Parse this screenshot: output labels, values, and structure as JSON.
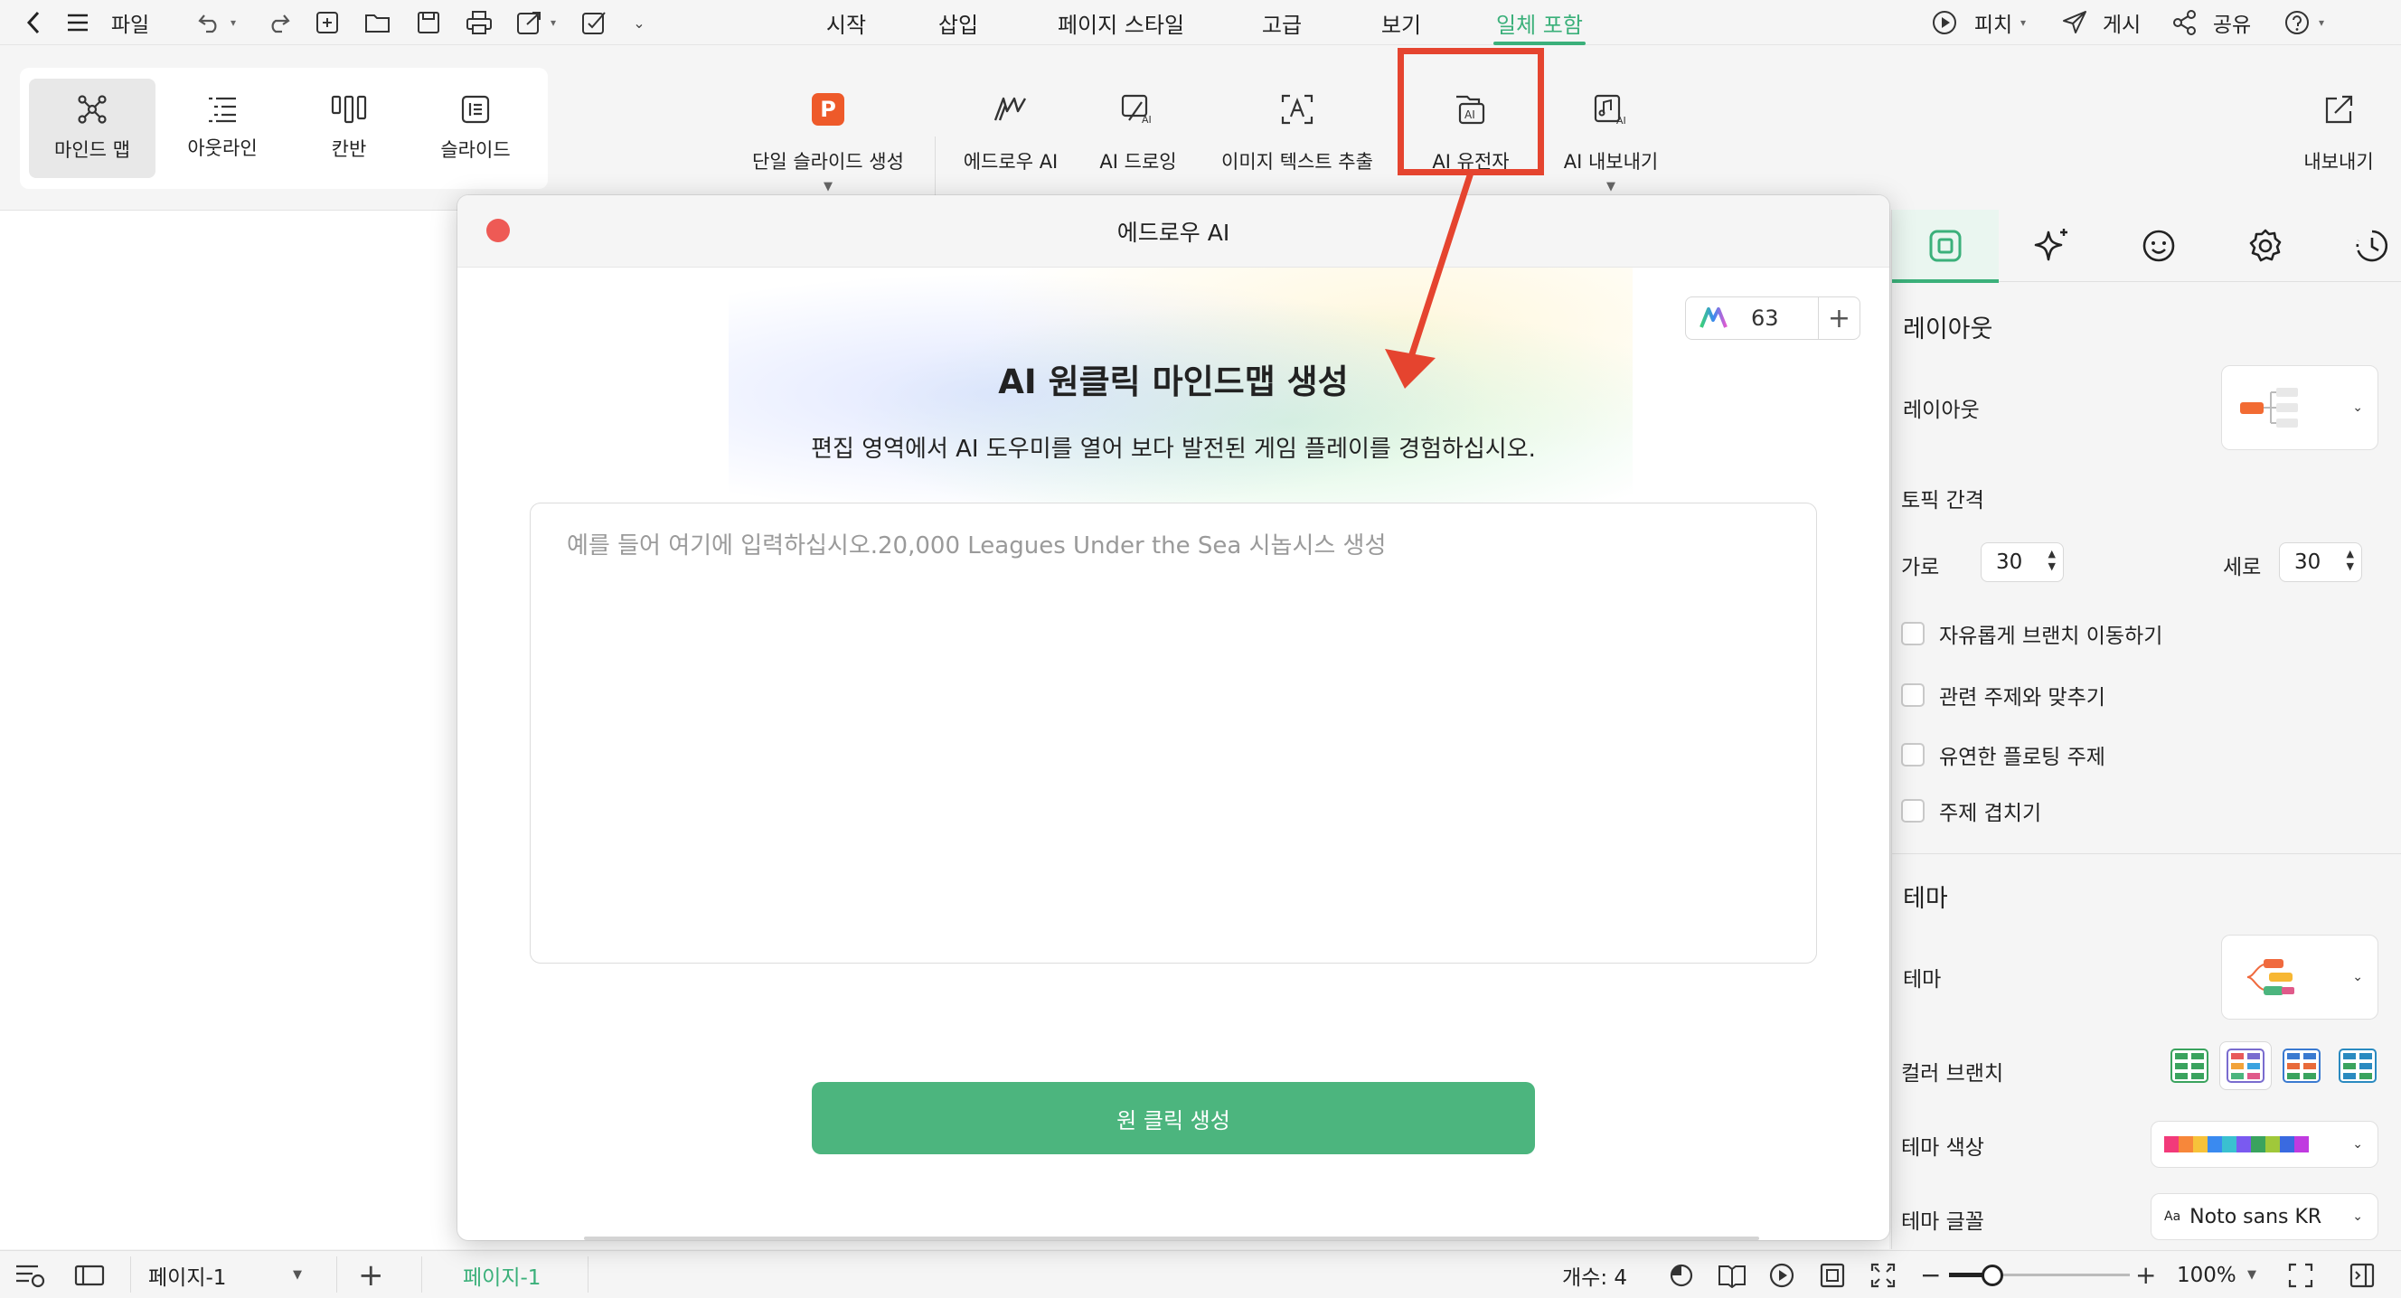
{
  "menubar": {
    "file_label": "파일",
    "tabs": [
      {
        "label": "시작"
      },
      {
        "label": "삽입"
      },
      {
        "label": "페이지 스타일"
      },
      {
        "label": "고급"
      },
      {
        "label": "보기"
      },
      {
        "label": "일체 포함"
      }
    ],
    "pitch_label": "피치",
    "publish_label": "게시",
    "share_label": "공유"
  },
  "ribbon": {
    "views": [
      {
        "label": "마인드 맵"
      },
      {
        "label": "아웃라인"
      },
      {
        "label": "칸반"
      },
      {
        "label": "슬라이드"
      }
    ],
    "tools": [
      {
        "label": "단일 슬라이드 생성"
      },
      {
        "label": "에드로우 AI"
      },
      {
        "label": "AI 드로잉"
      },
      {
        "label": "이미지 텍스트 추출"
      },
      {
        "label": "AI 유전자"
      },
      {
        "label": "AI 내보내기"
      }
    ],
    "export_label": "내보내기",
    "slide_icon_letter": "P"
  },
  "dialog": {
    "title": "에드로우 AI",
    "credits": "63",
    "heading": "AI 원클릭 마인드맵 생성",
    "subheading": "편집 영역에서 AI 도우미를 열어 보다 발전된 게임 플레이를 경험하십시오.",
    "prompt_placeholder": "예를 들어 여기에 입력하십시오.20,000 Leagues Under the Sea 시놉시스 생성",
    "generate_label": "원 클릭 생성"
  },
  "panel": {
    "layout_section": "레이아웃",
    "layout_label": "레이아웃",
    "topic_spacing_label": "토픽 간격",
    "horizontal_label": "가로",
    "horizontal_value": "30",
    "vertical_label": "세로",
    "vertical_value": "30",
    "checkboxes": [
      {
        "label": "자유롭게 브랜치 이동하기"
      },
      {
        "label": "관련 주제와 맞추기"
      },
      {
        "label": "유연한 플로팅 주제"
      },
      {
        "label": "주제 겹치기"
      }
    ],
    "theme_section": "테마",
    "theme_label": "테마",
    "color_branch_label": "컬러 브랜치",
    "theme_color_label": "테마 색상",
    "theme_font_label": "테마 글꼴",
    "theme_font_value": "Noto sans KR",
    "theme_font_prefix": "Aa"
  },
  "statusbar": {
    "page_name": "페이지-1",
    "active_page_tab": "페이지-1",
    "count_text": "개수: 4",
    "zoom_text": "100%"
  },
  "colors": {
    "accent": "#3bb07a",
    "button": "#4cb57e",
    "highlight": "#e5442f",
    "close": "#ee5a55"
  }
}
